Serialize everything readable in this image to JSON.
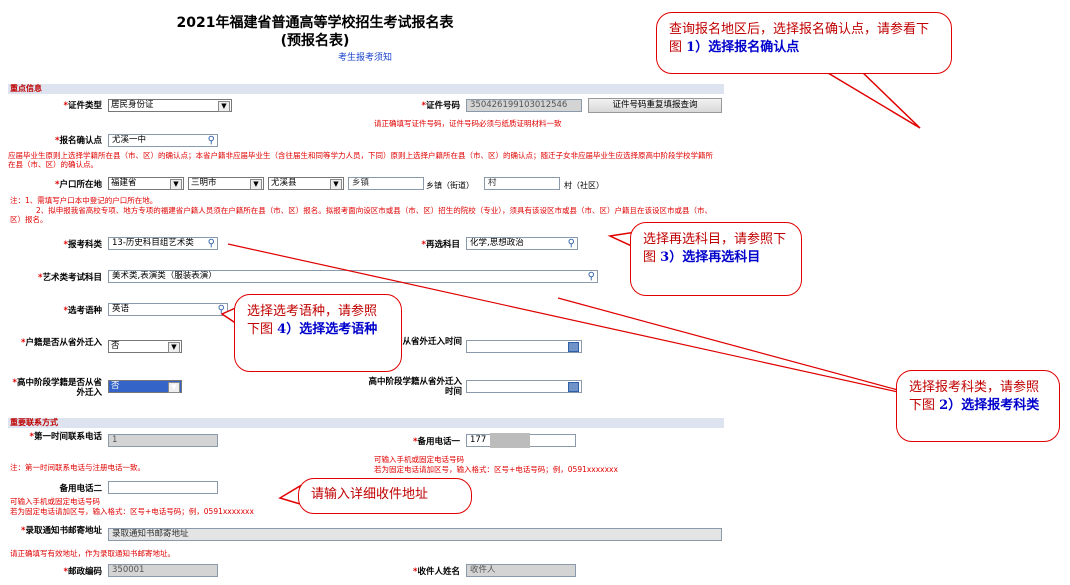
{
  "header": {
    "title1": "2021年福建省普通高等学校招生考试报名表",
    "title2": "(预报名表)",
    "notice_link": "考生报考须知"
  },
  "sections": {
    "key_info": "重点信息",
    "contact": "重要联系方式"
  },
  "form": {
    "id_type_label": "证件类型",
    "id_type_value": "居民身份证",
    "id_number_label": "证件号码",
    "id_number_value": "350426199103012546",
    "id_dup_button": "证件号码重复填报查询",
    "id_note": "请正确填写证件号码，证件号码必须与纸质证明材料一致",
    "confirm_point_label": "报名确认点",
    "confirm_point_value": "尤溪一中",
    "confirm_note": "应届毕业生原则上选择学籍所在县（市、区）的确认点；本省户籍非应届毕业生（含往届生和同等学力人员，下同）原则上选择户籍所在县（市、区）的确认点；随迁子女非应届毕业生应选择原高中阶段学校学籍所在县（市、区）的确认点。",
    "hukou_label": "户口所在地",
    "hukou_province": "福建省",
    "hukou_city": "三明市",
    "hukou_county": "尤溪县",
    "hukou_town": "乡镇",
    "hukou_town_suffix": "乡镇（街道）",
    "hukou_village": "村",
    "hukou_village_suffix": "村（社区）",
    "hukou_note1": "注：1、需填写户口本中登记的户口所在地。",
    "hukou_note2": "2、拟申报我省高校专项、地方专项的福建省户籍人员须在户籍所在县（市、区）报名。拟报考面向设区市或县（市、区）招生的院校（专业），须具有该设区市或县（市、区）户籍且在该设区市或县（市、区）报名。",
    "subject_label": "报考科类",
    "subject_value": "13-历史科目组艺术类",
    "reselect_label": "再选科目",
    "reselect_value": "化学,思想政治",
    "art_label": "艺术类考试科目",
    "art_value": "美术类,表演类（服装表演）",
    "language_label": "选考语种",
    "language_value": "英语",
    "hukou_moved_label": "户籍是否从省外迁入",
    "hukou_moved_value": "否",
    "hukou_moved_time_label": "户籍从省外迁入时间",
    "school_moved_label": "高中阶段学籍是否从省外迁入",
    "school_moved_value": "否",
    "school_moved_time_label": "高中阶段学籍从省外迁入时间",
    "phone1_label": "第一时间联系电话",
    "phone1_value": "1",
    "phone_backup1_label": "备用电话一",
    "phone_backup1_value": "177",
    "phone1_note": "注：第一时间联系电话与注册电话一致。",
    "backup1_note1": "可输入手机或固定电话号码",
    "backup1_note2": "若为固定电话请加区号，输入格式：区号+电话号码；例，0591xxxxxxx",
    "phone_backup2_label": "备用电话二",
    "backup2_note1": "可输入手机或固定电话号码",
    "backup2_note2": "若为固定电话请加区号，输入格式：区号+电话号码；例，0591xxxxxxx",
    "mail_addr_label": "录取通知书邮寄地址",
    "mail_addr_value": "录取通知书邮寄地址",
    "mail_addr_note": "请正确填写有效地址，作为录取通知书邮寄地址。",
    "postcode_label": "邮政编码",
    "postcode_value": "350001",
    "recipient_label": "收件人姓名",
    "recipient_value": "收件人"
  },
  "annotations": {
    "c1_text": "查询报名地区后，选择报名确认点，请参看下图",
    "c1_bold": "1）选择报名确认点",
    "c2_text": "选择再选科目，请参照下图",
    "c2_bold": "3）选择再选科目",
    "c3_text": "选择选考语种，请参照下图",
    "c3_bold": "4）选择选考语种",
    "c4_text": "选择报考科类，请参照下图",
    "c4_bold": "2）选择报考科类",
    "c5_text": "请输入详细收件地址"
  }
}
